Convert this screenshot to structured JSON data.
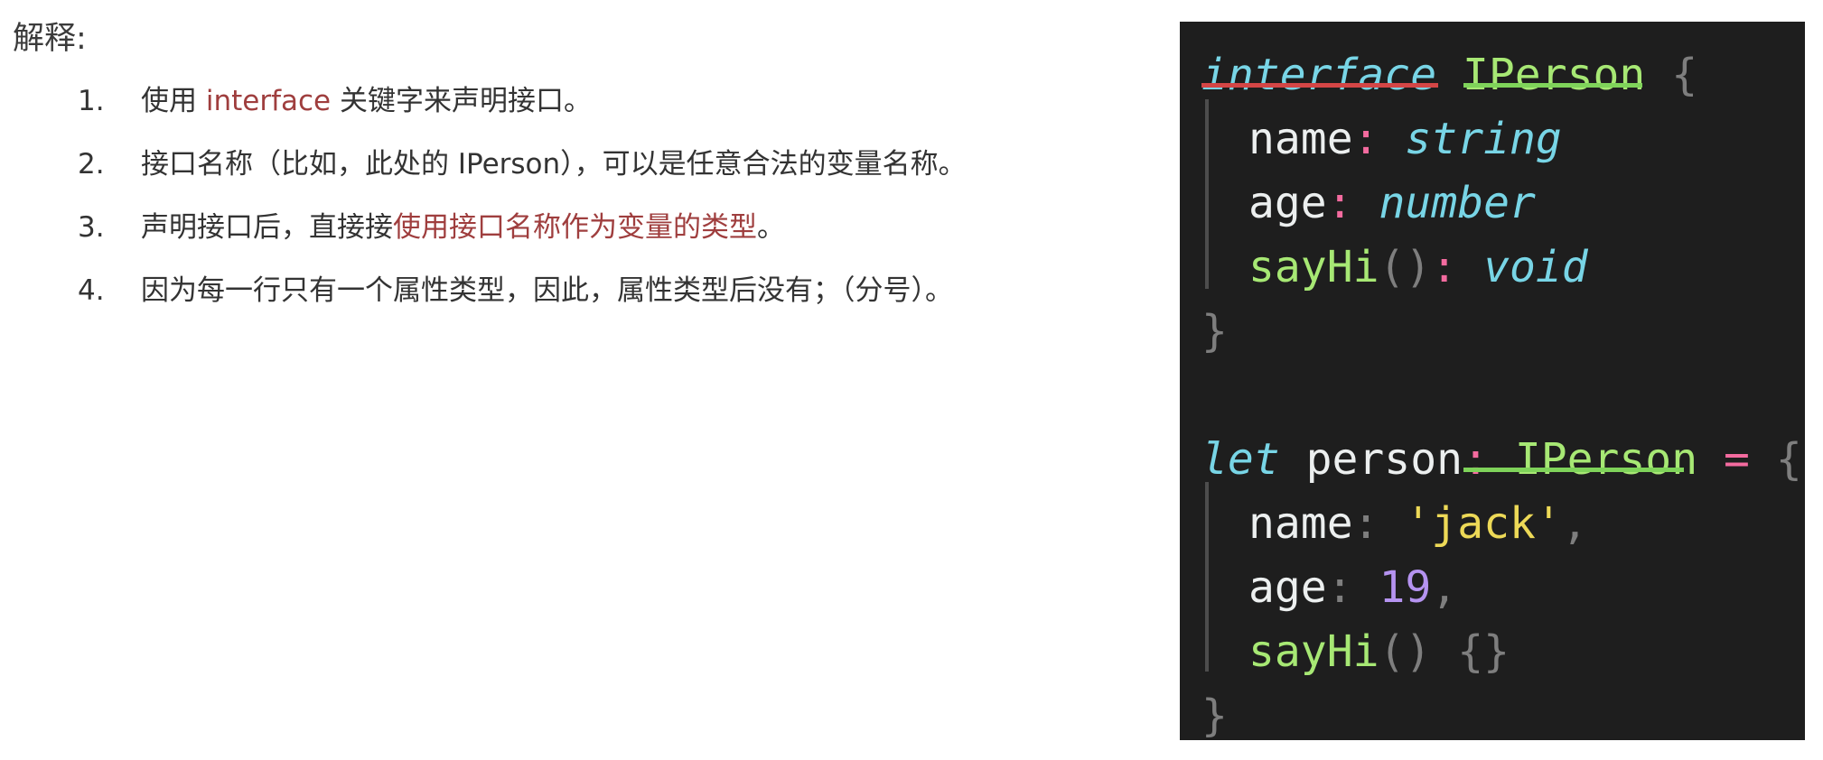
{
  "heading": "解释:",
  "items": [
    {
      "num": "1.",
      "pre": "使用 ",
      "highlight": "interface",
      "post": " 关键字来声明接口。"
    },
    {
      "num": "2.",
      "pre": "接口名称（比如，此处的 IPerson），可以是任意合法的变量名称。",
      "highlight": "",
      "post": ""
    },
    {
      "num": "3.",
      "pre": "声明接口后，直接接",
      "highlight": "使用接口名称作为变量的类型",
      "post": "。"
    },
    {
      "num": "4.",
      "pre": "因为每一行只有一个属性类型，因此，属性类型后没有；（分号）。",
      "highlight": "",
      "post": ""
    }
  ],
  "code": {
    "kw_interface": "interface",
    "iface_name": "IPerson",
    "open_brace": "{",
    "close_brace": "}",
    "prop_name": "name",
    "type_string": "string",
    "prop_age": "age",
    "type_number": "number",
    "prop_sayhi": "sayHi",
    "parens": "()",
    "type_void": "void",
    "colon": ":",
    "kw_let": "let",
    "var_person": "person",
    "equals": "=",
    "str_jack": "'jack'",
    "val_age": "19",
    "comma": ",",
    "empty_body": "{}"
  },
  "colors": {
    "code_background": "#1e1e1e",
    "keyword": "#78d5e6",
    "type_name": "#a7e874",
    "string": "#edd957",
    "number": "#b593f0",
    "operator": "#f46b9f",
    "highlight_text": "#9f3e3e",
    "underline_red": "#d44646",
    "underline_green": "#7fd35a"
  }
}
